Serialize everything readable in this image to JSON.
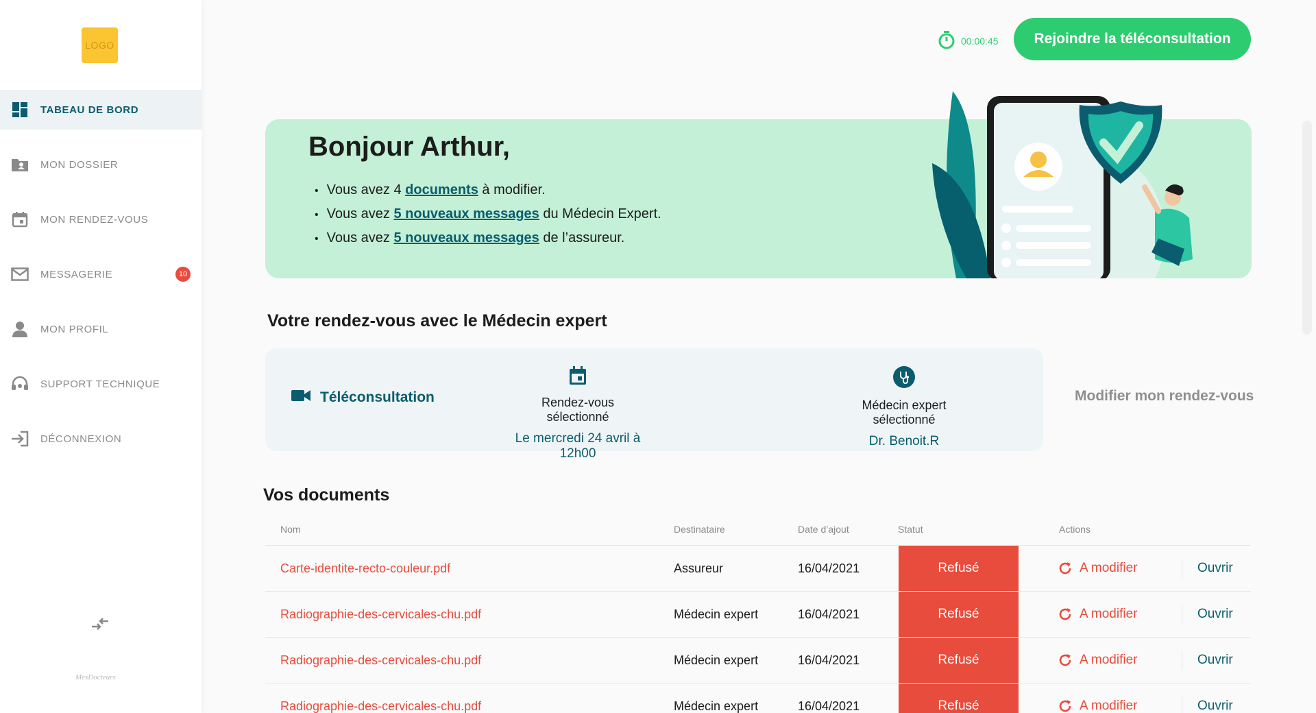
{
  "sidebar": {
    "logo_text": "LOGO",
    "items": [
      {
        "label": "TABEAU DE BORD",
        "icon": "dashboard-icon",
        "active": true
      },
      {
        "label": "MON DOSSIER",
        "icon": "folder-user-icon"
      },
      {
        "label": "MON RENDEZ-VOUS",
        "icon": "calendar-icon"
      },
      {
        "label": "MESSAGERIE",
        "icon": "mail-icon",
        "badge": "10"
      },
      {
        "label": "MON PROFIL",
        "icon": "user-icon"
      },
      {
        "label": "SUPPORT TECHNIQUE",
        "icon": "headset-icon"
      },
      {
        "label": "DÉCONNEXION",
        "icon": "logout-icon"
      }
    ],
    "footer_brand": "MesDocteurs"
  },
  "header": {
    "timer": "00:00:45",
    "join_label": "Rejoindre la téléconsultation"
  },
  "welcome": {
    "title": "Bonjour Arthur,",
    "line1": {
      "pre": "Vous avez 4",
      "link": "documents",
      "post": "à modifier."
    },
    "line2": {
      "pre": "Vous avez",
      "link": "5 nouveaux messages",
      "post": "du Médecin Expert."
    },
    "line3": {
      "pre": "Vous avez",
      "link": "5 nouveaux messages",
      "post": "de l’assureur."
    }
  },
  "appointment": {
    "section_title": "Votre rendez-vous avec le Médecin expert",
    "type": "Téléconsultation",
    "date_label": "Rendez-vous sélectionné",
    "date_value": "Le mercredi 24 avril à 12h00",
    "doctor_label": "Médecin expert sélectionné",
    "doctor_value": "Dr. Benoit.R",
    "modify_label": "Modifier mon rendez-vous"
  },
  "documents": {
    "section_title": "Vos documents",
    "headers": {
      "name": "Nom",
      "recipient": "Destinataire",
      "date": "Date d’ajout",
      "status": "Statut",
      "actions": "Actions"
    },
    "rows": [
      {
        "name": "Carte-identite-recto-couleur.pdf",
        "recipient": "Assureur",
        "date": "16/04/2021",
        "status": "Refusé",
        "edit": "A modifier",
        "open": "Ouvrir"
      },
      {
        "name": "Radiographie-des-cervicales-chu.pdf",
        "recipient": "Médecin expert",
        "date": "16/04/2021",
        "status": "Refusé",
        "edit": "A modifier",
        "open": "Ouvrir"
      },
      {
        "name": "Radiographie-des-cervicales-chu.pdf",
        "recipient": "Médecin expert",
        "date": "16/04/2021",
        "status": "Refusé",
        "edit": "A modifier",
        "open": "Ouvrir"
      },
      {
        "name": "Radiographie-des-cervicales-chu.pdf",
        "recipient": "Médecin expert",
        "date": "16/04/2021",
        "status": "Refusé",
        "edit": "A modifier",
        "open": "Ouvrir"
      }
    ]
  },
  "colors": {
    "primary": "#0b5c6e",
    "green": "#2ecc71",
    "banner": "#c3f0d6",
    "danger": "#e74c3c",
    "logo": "#fbc531"
  }
}
